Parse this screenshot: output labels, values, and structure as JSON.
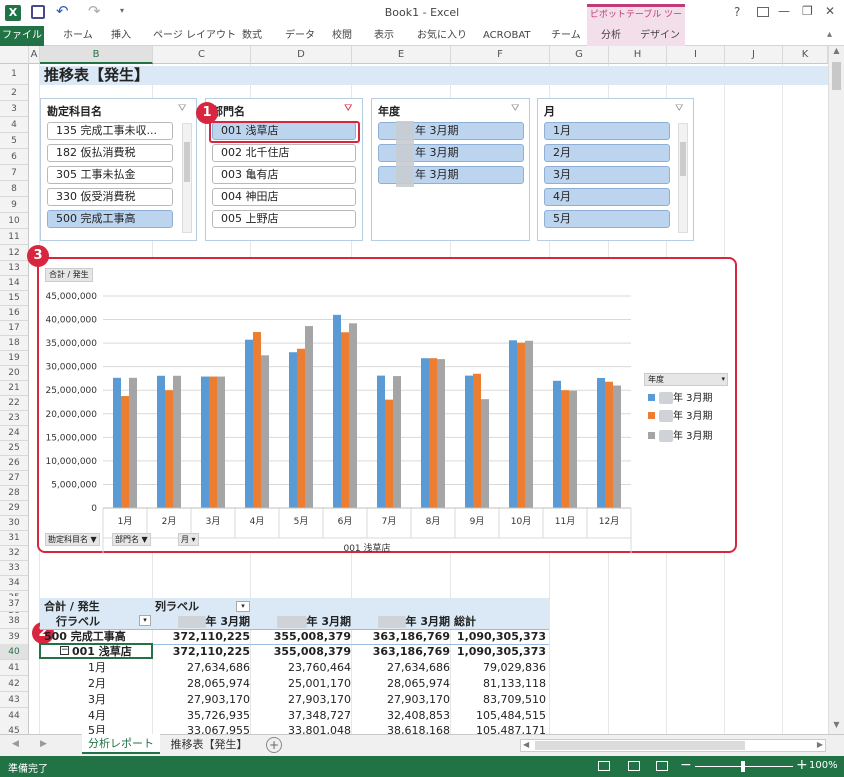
{
  "window": {
    "title": "Book1 - Excel",
    "pivot_tools_label": "ピボットテーブル ツール",
    "help": "?",
    "minimize": "—",
    "restore": "❐",
    "close": "✕"
  },
  "ribbon": {
    "tabs": [
      "ファイル",
      "ホーム",
      "挿入",
      "ページ レイアウト",
      "数式",
      "データ",
      "校閲",
      "表示",
      "お気に入り",
      "ACROBAT",
      "チーム",
      "分析",
      "デザイン"
    ]
  },
  "columns": [
    "A",
    "B",
    "C",
    "D",
    "E",
    "F",
    "G",
    "H",
    "I",
    "J",
    "K"
  ],
  "rows": [
    "1",
    "2",
    "3",
    "4",
    "5",
    "6",
    "7",
    "8",
    "9",
    "10",
    "11",
    "12",
    "13",
    "14",
    "15",
    "16",
    "17",
    "18",
    "19",
    "20",
    "21",
    "22",
    "23",
    "24",
    "25",
    "26",
    "27",
    "28",
    "29",
    "30",
    "31",
    "32",
    "33",
    "34",
    "35",
    "36",
    "37",
    "38",
    "39",
    "40",
    "41",
    "42",
    "43",
    "44",
    "45"
  ],
  "sheet_title": "推移表【発生】",
  "slicers": {
    "account": {
      "title": "勘定科目名",
      "items": [
        "135 完成工事未収...",
        "182 仮払消費税",
        "305 工事未払金",
        "330 仮受消費税",
        "500 完成工事高"
      ]
    },
    "department": {
      "title": "部門名",
      "items": [
        "001 浅草店",
        "002 北千住店",
        "003 亀有店",
        "004 神田店",
        "005 上野店"
      ]
    },
    "year": {
      "title": "年度",
      "items": [
        "年 3月期",
        "年 3月期",
        "年 3月期"
      ]
    },
    "month": {
      "title": "月",
      "items": [
        "1月",
        "2月",
        "3月",
        "4月",
        "5月"
      ]
    }
  },
  "markers": [
    "1",
    "2",
    "3"
  ],
  "chart_data": {
    "type": "bar",
    "value_field_button": "合計 / 発生",
    "categories": [
      "1月",
      "2月",
      "3月",
      "4月",
      "5月",
      "6月",
      "7月",
      "8月",
      "9月",
      "10月",
      "11月",
      "12月"
    ],
    "series": [
      {
        "name": "年 3月期",
        "color": "#5b9bd5",
        "values": [
          27634686,
          28065974,
          27903170,
          35726935,
          33067955,
          41000000,
          28100000,
          31800000,
          28100000,
          35600000,
          27000000,
          27600000
        ]
      },
      {
        "name": "年 3月期",
        "color": "#ed7d31",
        "values": [
          23760464,
          25001170,
          27903170,
          37348727,
          33801048,
          37300000,
          23000000,
          31800000,
          28500000,
          35100000,
          25000000,
          26800000
        ]
      },
      {
        "name": "年 3月期",
        "color": "#a5a5a5",
        "values": [
          27634686,
          28065974,
          27903170,
          32408853,
          38618168,
          39200000,
          28000000,
          31600000,
          23100000,
          35500000,
          24900000,
          26000000
        ]
      }
    ],
    "yticks": [
      "0",
      "5,000,000",
      "10,000,000",
      "15,000,000",
      "20,000,000",
      "25,000,000",
      "30,000,000",
      "35,000,000",
      "40,000,000",
      "45,000,000"
    ],
    "ylim": [
      0,
      45000000
    ],
    "axis_label_1": "001 浅草店",
    "axis_label_2": "500 完成工事高",
    "legend_title": "年度",
    "field_buttons": [
      "勘定科目名",
      "部門名",
      "月"
    ]
  },
  "pivot": {
    "title": "合計 / 発生",
    "col_label": "列ラベル",
    "row_label": "行ラベル",
    "col_headers": [
      "年 3月期",
      "年 3月期",
      "年 3月期",
      "総計"
    ],
    "rows": [
      {
        "label": "500 完成工事高",
        "values": [
          "372,110,225",
          "355,008,379",
          "363,186,769",
          "1,090,305,373"
        ]
      },
      {
        "label": "001 浅草店",
        "values": [
          "372,110,225",
          "355,008,379",
          "363,186,769",
          "1,090,305,373"
        ]
      },
      {
        "label": "1月",
        "values": [
          "27,634,686",
          "23,760,464",
          "27,634,686",
          "79,029,836"
        ]
      },
      {
        "label": "2月",
        "values": [
          "28,065,974",
          "25,001,170",
          "28,065,974",
          "81,133,118"
        ]
      },
      {
        "label": "3月",
        "values": [
          "27,903,170",
          "27,903,170",
          "27,903,170",
          "83,709,510"
        ]
      },
      {
        "label": "4月",
        "values": [
          "35,726,935",
          "37,348,727",
          "32,408,853",
          "105,484,515"
        ]
      },
      {
        "label": "5月",
        "values": [
          "33,067,955",
          "33,801,048",
          "38,618,168",
          "105,487,171"
        ]
      }
    ]
  },
  "sheet_tabs": [
    "分析レポート",
    "推移表【発生】"
  ],
  "status": {
    "ready": "準備完了",
    "zoom": "100%"
  }
}
